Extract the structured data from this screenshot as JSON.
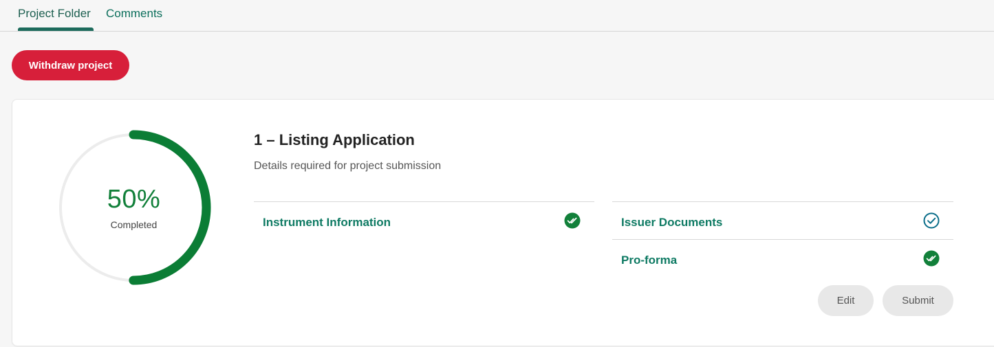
{
  "tabs": [
    {
      "label": "Project Folder",
      "active": true
    },
    {
      "label": "Comments",
      "active": false
    }
  ],
  "withdraw_label": "Withdraw project",
  "progress": {
    "percent_text": "50%",
    "value": 0.5,
    "label": "Completed",
    "color": "#0b7d35",
    "track_color": "#ececec"
  },
  "section": {
    "title": "1 – Listing Application",
    "subtitle": "Details required for project submission"
  },
  "items_left": [
    {
      "label": "Instrument Information",
      "icon": "double-check-filled-icon"
    }
  ],
  "items_right": [
    {
      "label": "Issuer Documents",
      "icon": "check-circle-outline-icon"
    },
    {
      "label": "Pro-forma",
      "icon": "double-check-filled-icon"
    }
  ],
  "buttons": {
    "edit": "Edit",
    "submit": "Submit"
  },
  "colors": {
    "accent_green": "#0e7a63",
    "success_green": "#12803a",
    "danger_red": "#d71f3a",
    "outline_teal": "#0b6e8a"
  }
}
